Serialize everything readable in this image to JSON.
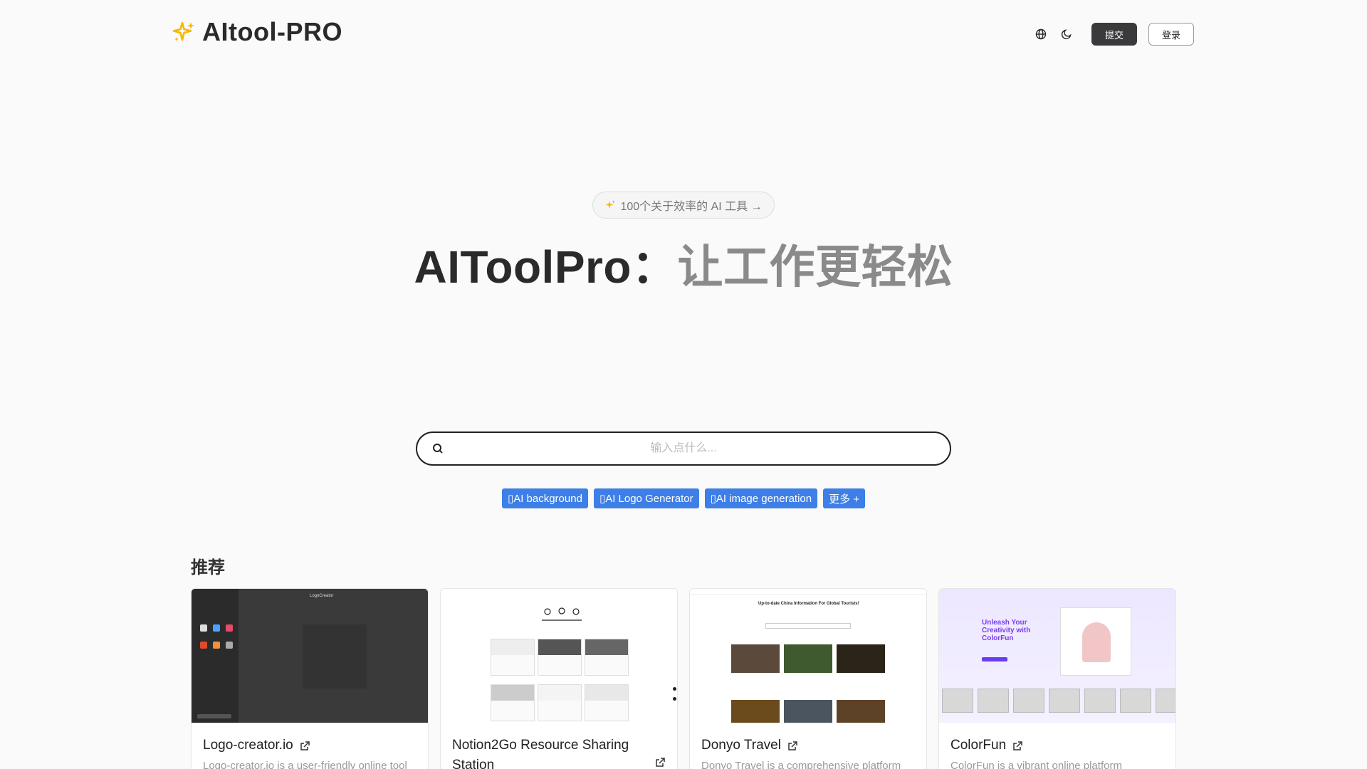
{
  "header": {
    "brand": "AItool-PRO",
    "submit_label": "提交",
    "login_label": "登录"
  },
  "hero": {
    "badge_text": "100个关于效率的 AI 工具 →",
    "title_part1": "AIToolPro：",
    "title_part2": "让工作更轻松"
  },
  "search": {
    "placeholder": "输入点什么..."
  },
  "tags": [
    {
      "label": "▯AI background"
    },
    {
      "label": "▯AI Logo Generator"
    },
    {
      "label": "▯AI image generation"
    },
    {
      "label": "更多 +"
    }
  ],
  "section": {
    "title": "推荐"
  },
  "cards": [
    {
      "title": "Logo-creator.io",
      "desc": "Logo-creator.io is a user-friendly online tool"
    },
    {
      "title": "Notion2Go Resource Sharing Station",
      "desc": ""
    },
    {
      "title": "Donyo Travel",
      "desc": "Donyo Travel is a comprehensive platform"
    },
    {
      "title": "ColorFun",
      "desc": "ColorFun is a vibrant online platform"
    }
  ],
  "thumbs": {
    "logo_creator_brand": "LogoCreator",
    "donyo_heading": "Up-to-date China Information For Global Tourists!",
    "colorfun_heading": "Unleash Your Creativity with ColorFun"
  },
  "colors": {
    "accent_tag": "#3d7fe6",
    "dark_button": "#3a3a3c",
    "brand_star": "#f5b800"
  }
}
